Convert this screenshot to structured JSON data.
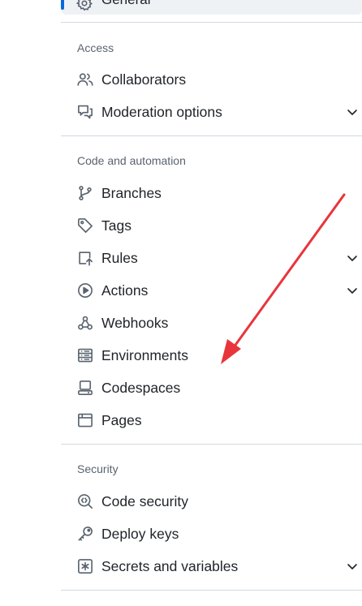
{
  "general_item": {
    "label": "General"
  },
  "sections": {
    "access": {
      "title": "Access",
      "collaborators": "Collaborators",
      "moderation": "Moderation options"
    },
    "code_automation": {
      "title": "Code and automation",
      "branches": "Branches",
      "tags": "Tags",
      "rules": "Rules",
      "actions": "Actions",
      "webhooks": "Webhooks",
      "environments": "Environments",
      "codespaces": "Codespaces",
      "pages": "Pages"
    },
    "security": {
      "title": "Security",
      "code_security": "Code security",
      "deploy_keys": "Deploy keys",
      "secrets": "Secrets and variables"
    }
  },
  "colors": {
    "accent": "#0969da",
    "annotation_arrow": "#e8353b",
    "icon": "#59636e"
  },
  "icons": {
    "general": "gear-icon",
    "collaborators": "people-icon",
    "moderation": "comment-discussion-icon",
    "branches": "git-branch-icon",
    "tags": "tag-icon",
    "rules": "repo-push-icon",
    "actions": "play-icon",
    "webhooks": "webhook-icon",
    "environments": "server-icon",
    "codespaces": "codespaces-icon",
    "pages": "browser-icon",
    "code_security": "codescan-icon",
    "deploy_keys": "key-icon",
    "secrets": "asterisk-icon",
    "expand": "chevron-down-icon"
  }
}
